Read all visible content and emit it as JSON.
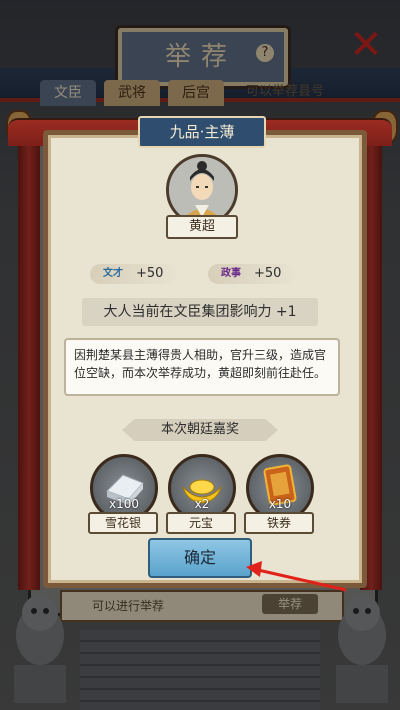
{
  "background": {
    "title": "举荐",
    "help_icon": "question-icon",
    "close_icon": "close-x-icon",
    "tabs": [
      {
        "label": "文臣",
        "active": true
      },
      {
        "label": "武将",
        "active": false
      },
      {
        "label": "后宫",
        "active": false
      }
    ],
    "sub_text": "可以举荐县号",
    "footer_text": "可以进行举荐",
    "footer_button": "举荐"
  },
  "dialog": {
    "rank": "九品·主薄",
    "character_name": "黄超",
    "stats": [
      {
        "icon": "literary-stat-icon",
        "value": "+50"
      },
      {
        "icon": "political-stat-icon",
        "value": "+50"
      }
    ],
    "influence": "大人当前在文臣集团影响力 +1",
    "story": "因荆楚某县主薄得贵人相助，官升三级，造成官位空缺，而本次举荐成功，黄超即刻前往赴任。",
    "reward_header": "本次朝廷嘉奖",
    "rewards": [
      {
        "icon": "silver-ingot-icon",
        "count": "x100",
        "label": "雪花银"
      },
      {
        "icon": "gold-yuanbao-icon",
        "count": "x2",
        "label": "元宝"
      },
      {
        "icon": "iron-voucher-icon",
        "count": "x10",
        "label": "铁券"
      }
    ],
    "confirm": "确定"
  },
  "colors": {
    "confirm_button": "#6bb4d9",
    "annotation_arrow": "#e0221b",
    "rank_badge": "#2f4d6e"
  }
}
